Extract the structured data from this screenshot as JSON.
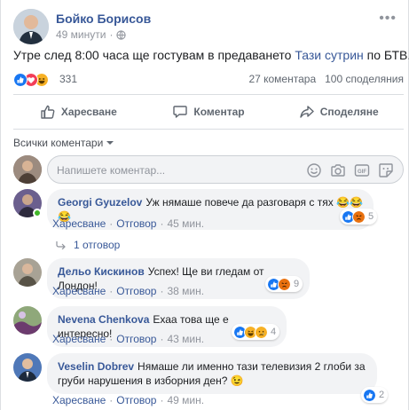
{
  "post": {
    "author": "Бойко Борисов",
    "time": "49 минути",
    "more_icon": "more-icon",
    "text_before": "Утре след 8:00 часа ще гостувам в предаването ",
    "text_link": "Тази сутрин",
    "text_after": " по БТВ."
  },
  "summary": {
    "reactions": [
      "like",
      "love",
      "haha"
    ],
    "reaction_count": "331",
    "comments": "27 коментара",
    "shares": "100 споделяния"
  },
  "actions": {
    "like": "Харесване",
    "comment": "Коментар",
    "share": "Споделяне"
  },
  "comments_filter": "Всички коментари",
  "composer": {
    "placeholder": "Напишете коментар...",
    "tools": [
      "emoji-icon",
      "camera-icon",
      "gif-icon",
      "sticker-icon"
    ]
  },
  "comment_actions": {
    "like": "Харесване",
    "reply": "Отговор",
    "separator": "·"
  },
  "comments": [
    {
      "name": "Georgi Gyuzelov",
      "text": "Уж нямаше повече да разговаря с тях 😂😂😂",
      "time": "45 мин.",
      "reaction_count": "5",
      "reactions": [
        "like",
        "angry"
      ],
      "replies": "1 отговор"
    },
    {
      "name": "Дельо Кискинов",
      "text": "Успех! Ще ви гледам от Лондон!",
      "time": "38 мин.",
      "reaction_count": "9",
      "reactions": [
        "like",
        "angry"
      ]
    },
    {
      "name": "Nevena Chenkova",
      "text": "Ехаа това ще е интересно!",
      "time": "43 мин.",
      "reaction_count": "4",
      "reactions": [
        "like",
        "haha",
        "sad"
      ]
    },
    {
      "name": "Veselin Dobrev",
      "text_line1": "Нямаше ли именно тази телевизия 2 глоби за",
      "text_line2": "груби нарушения в изборния ден? 😉",
      "time": "49 мин.",
      "reaction_count": "2",
      "reactions": [
        "like"
      ]
    }
  ],
  "colors": {
    "link": "#385898",
    "like": "#1877f2",
    "love": "#f33e58",
    "haha": "#f7b125",
    "angry": "#e9710f",
    "sad": "#f7b125",
    "online": "#42b72a"
  }
}
